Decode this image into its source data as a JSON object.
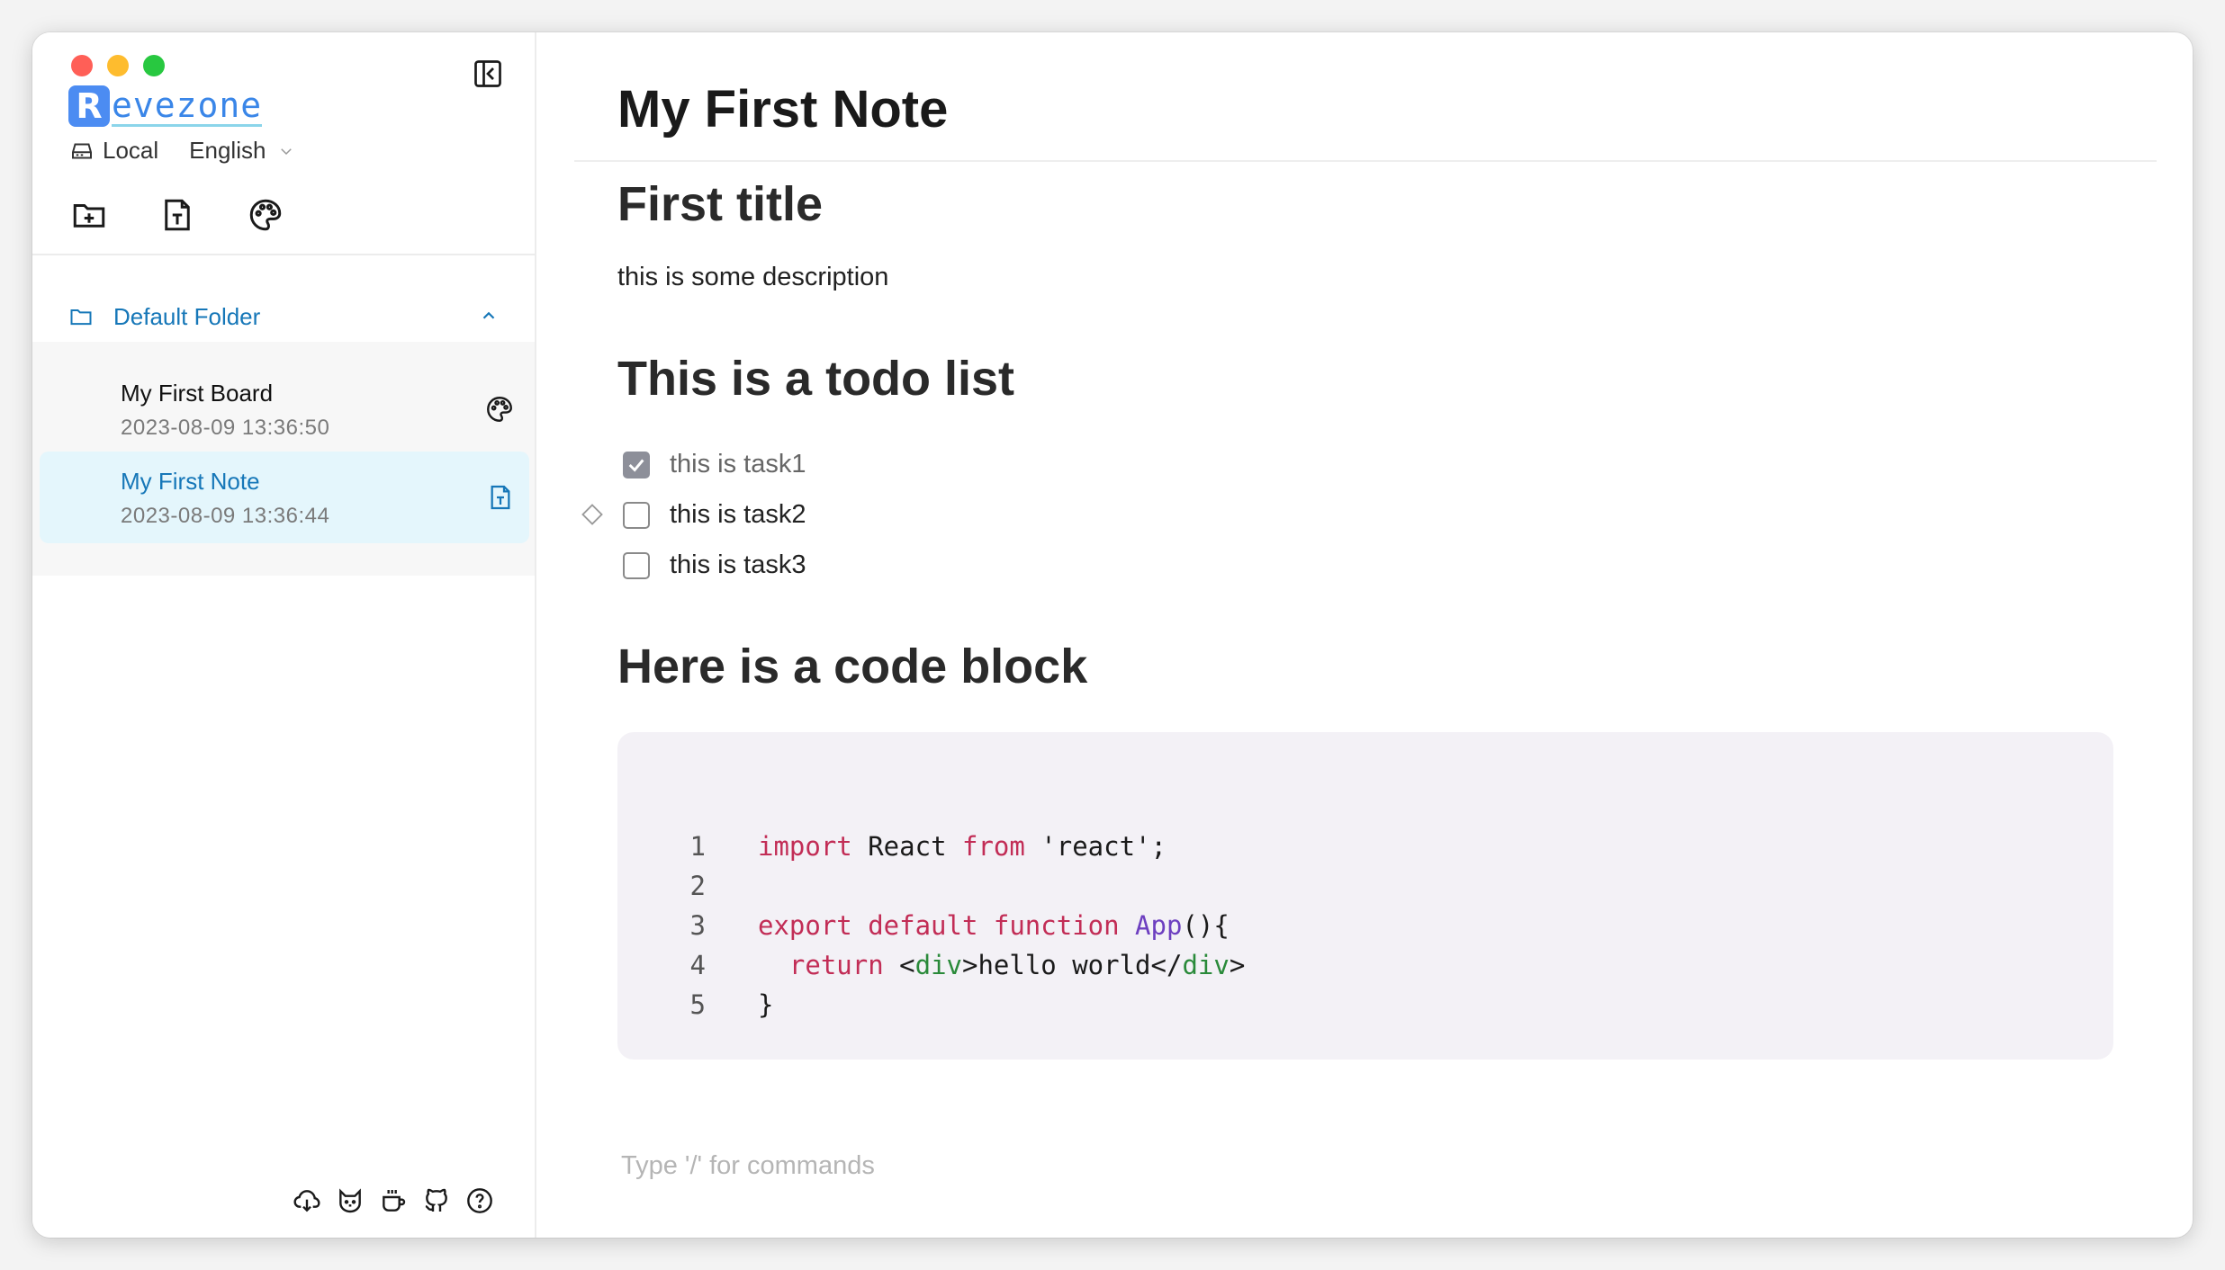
{
  "sidebar": {
    "logo_letter": "R",
    "logo_text": "evezone",
    "storage_label": "Local",
    "language": "English",
    "folder": {
      "label": "Default Folder",
      "expanded": true
    },
    "items": [
      {
        "name": "My First Board",
        "date": "2023-08-09 13:36:50",
        "type": "board-icon",
        "selected": false
      },
      {
        "name": "My First Note",
        "date": "2023-08-09 13:36:44",
        "type": "note-icon",
        "selected": true
      }
    ],
    "toolbar_icons": [
      "add-folder-icon",
      "add-note-icon",
      "add-board-icon"
    ],
    "footer_icons": [
      "download-icon",
      "cat-icon",
      "coffee-icon",
      "github-icon",
      "help-icon"
    ]
  },
  "editor": {
    "title": "My First Note",
    "heading1": "First title",
    "description": "this is some description",
    "heading2": "This is a todo list",
    "todos": [
      {
        "label": "this is task1",
        "checked": true
      },
      {
        "label": "this is task2",
        "checked": false
      },
      {
        "label": "this is task3",
        "checked": false
      }
    ],
    "heading3": "Here is a code block",
    "code": {
      "line_numbers": [
        "1",
        "2",
        "3",
        "4",
        "5"
      ],
      "l1_kw1": "import",
      "l1_mid": " React ",
      "l1_kw2": "from",
      "l1_str": " 'react';",
      "l3_kw": "export default function ",
      "l3_fn": "App",
      "l3_rest": "(){",
      "l4_kw": "  return ",
      "l4_open_lt": "<",
      "l4_tag1": "div",
      "l4_text": ">hello world</",
      "l4_tag2": "div",
      "l4_close": ">",
      "l5": "}"
    },
    "command_placeholder": "Type '/' for commands"
  },
  "colors": {
    "accent": "#1677b8",
    "selected_bg": "#e4f6fc",
    "keyword": "#c22d56",
    "function": "#6d3fc0",
    "tag": "#2a8a3a",
    "code_bg": "#f3f1f6"
  }
}
